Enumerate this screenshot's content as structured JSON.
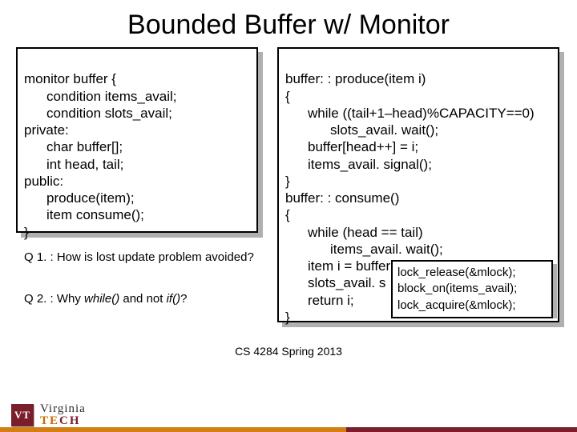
{
  "title": "Bounded Buffer w/ Monitor",
  "left_code": {
    "l1": "monitor buffer {",
    "l2": "condition items_avail;",
    "l3": "condition slots_avail;",
    "l4": "private:",
    "l5": "char buffer[];",
    "l6": "int head, tail;",
    "l7": "public:",
    "l8": "produce(item);",
    "l9": "item consume();",
    "l10": "}"
  },
  "right_code": {
    "r1": "buffer: : produce(item i)",
    "r2": "{",
    "r3": "while ((tail+1–head)%CAPACITY==0)",
    "r4": "slots_avail. wait();",
    "r5": "buffer[head++] = i;",
    "r6": "items_avail. signal();",
    "r7": "}",
    "r8": "buffer: : consume()",
    "r9": "{",
    "r10": "while (head == tail)",
    "r11": "items_avail. wait();",
    "r12a": "item i = buffer[t",
    "r13a": "slots_avail. s",
    "r14a": "return i;",
    "r15": "}"
  },
  "overlay": {
    "o1": "lock_release(&mlock);",
    "o2": "block_on(items_avail);",
    "o3": "lock_acquire(&mlock);"
  },
  "questions": {
    "q1_pre": "Q 1. : How is lost update problem avoided?",
    "q2_pre": "Q 2. : Why ",
    "q2_em1": "while()",
    "q2_mid": " and not ",
    "q2_em2": "if()",
    "q2_post": "?"
  },
  "footer": {
    "course": "CS 4284 Spring 2013",
    "logo_vt": "VT",
    "logo_virginia": "Virginia",
    "logo_tech": "TECH"
  }
}
